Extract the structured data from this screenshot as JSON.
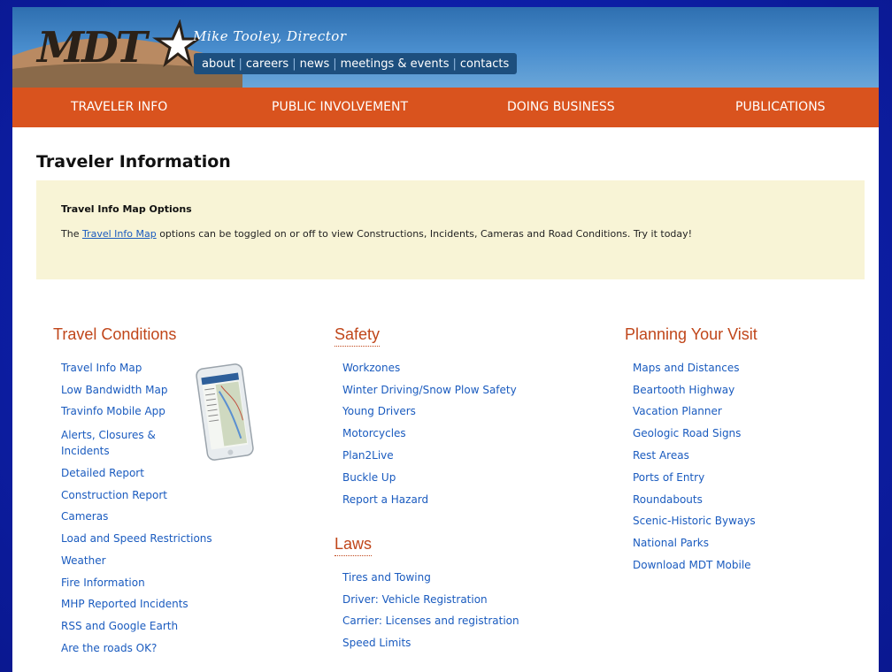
{
  "header": {
    "logo_text": "MDT",
    "director": "Mike Tooley, Director",
    "top_links": [
      "about",
      "careers",
      "news",
      "meetings & events",
      "contacts"
    ]
  },
  "nav": {
    "items": [
      "TRAVELER INFO",
      "PUBLIC INVOLVEMENT",
      "DOING BUSINESS",
      "PUBLICATIONS"
    ]
  },
  "page_title": "Traveler Information",
  "notice": {
    "title": "Travel Info Map Options",
    "text_before": "The ",
    "link": "Travel Info Map",
    "text_after": " options can be toggled on or off to view Constructions, Incidents, Cameras and Road Conditions. Try it today!"
  },
  "columns": {
    "travel_conditions": {
      "title": "Travel Conditions",
      "links": [
        "Travel Info Map",
        "Low Bandwidth Map",
        "Travinfo Mobile App",
        "Alerts, Closures &",
        "Incidents",
        "Detailed Report",
        "Construction Report",
        "Cameras",
        "Load and Speed Restrictions",
        "Weather",
        "Fire Information",
        "MHP Reported Incidents",
        "RSS and Google Earth",
        "Are the roads OK?"
      ]
    },
    "safety": {
      "title": "Safety",
      "links": [
        "Workzones",
        "Winter Driving/Snow Plow Safety",
        "Young Drivers",
        "Motorcycles",
        "Plan2Live",
        "Buckle Up",
        "Report a Hazard"
      ]
    },
    "laws": {
      "title": "Laws",
      "links": [
        "Tires and Towing",
        "Driver: Vehicle Registration",
        "Carrier: Licenses and registration",
        "Speed Limits"
      ]
    },
    "planning": {
      "title": "Planning Your Visit",
      "links": [
        "Maps and Distances",
        "Beartooth Highway",
        "Vacation Planner",
        "Geologic Road Signs",
        "Rest Areas",
        "Ports of Entry",
        "Roundabouts",
        "Scenic-Historic Byways",
        "National Parks",
        "Download MDT Mobile"
      ]
    }
  },
  "colors": {
    "orange": "#d9531e",
    "link": "#1a5bbf",
    "heading": "#c0461a",
    "notice_bg": "#f8f4d6"
  }
}
